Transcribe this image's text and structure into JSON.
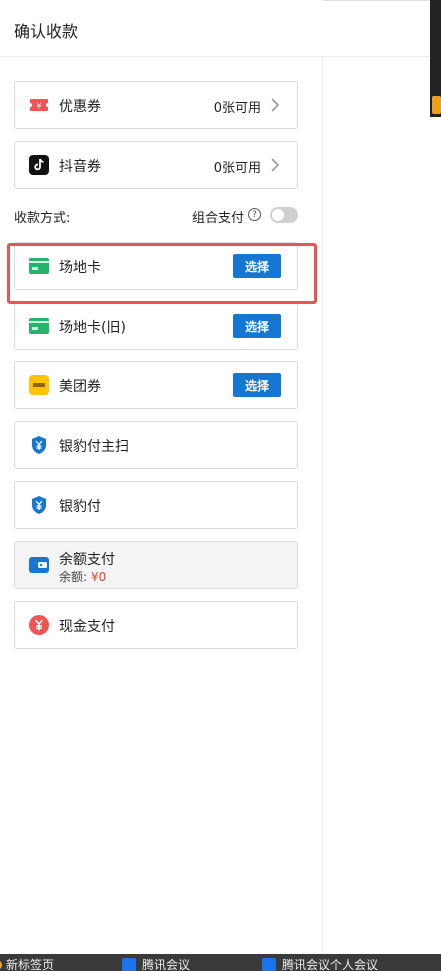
{
  "header": {
    "title": "确认收款"
  },
  "coupons": [
    {
      "label": "优惠券",
      "value": "0张可用"
    },
    {
      "label": "抖音券",
      "value": "0张可用"
    }
  ],
  "payment": {
    "section_label": "收款方式:",
    "combo_label": "组合支付",
    "help_glyph": "?",
    "methods": [
      {
        "label": "场地卡",
        "button": "选择"
      },
      {
        "label": "场地卡(旧)",
        "button": "选择"
      },
      {
        "label": "美团券",
        "button": "选择"
      },
      {
        "label": "银豹付主扫"
      },
      {
        "label": "银豹付"
      },
      {
        "label": "余额支付",
        "balance_label": "余额:",
        "balance_value": "¥0"
      },
      {
        "label": "现金支付"
      }
    ]
  },
  "taskbar": {
    "items": [
      "新标签页",
      "腾讯会议",
      "腾讯会议个人会议"
    ]
  },
  "colors": {
    "accent": "#1677d2",
    "highlight": "#e85555",
    "coupon_red": "#f25454",
    "green": "#27b36b",
    "meituan_yellow": "#ffc300",
    "balance_red": "#e8452c"
  }
}
